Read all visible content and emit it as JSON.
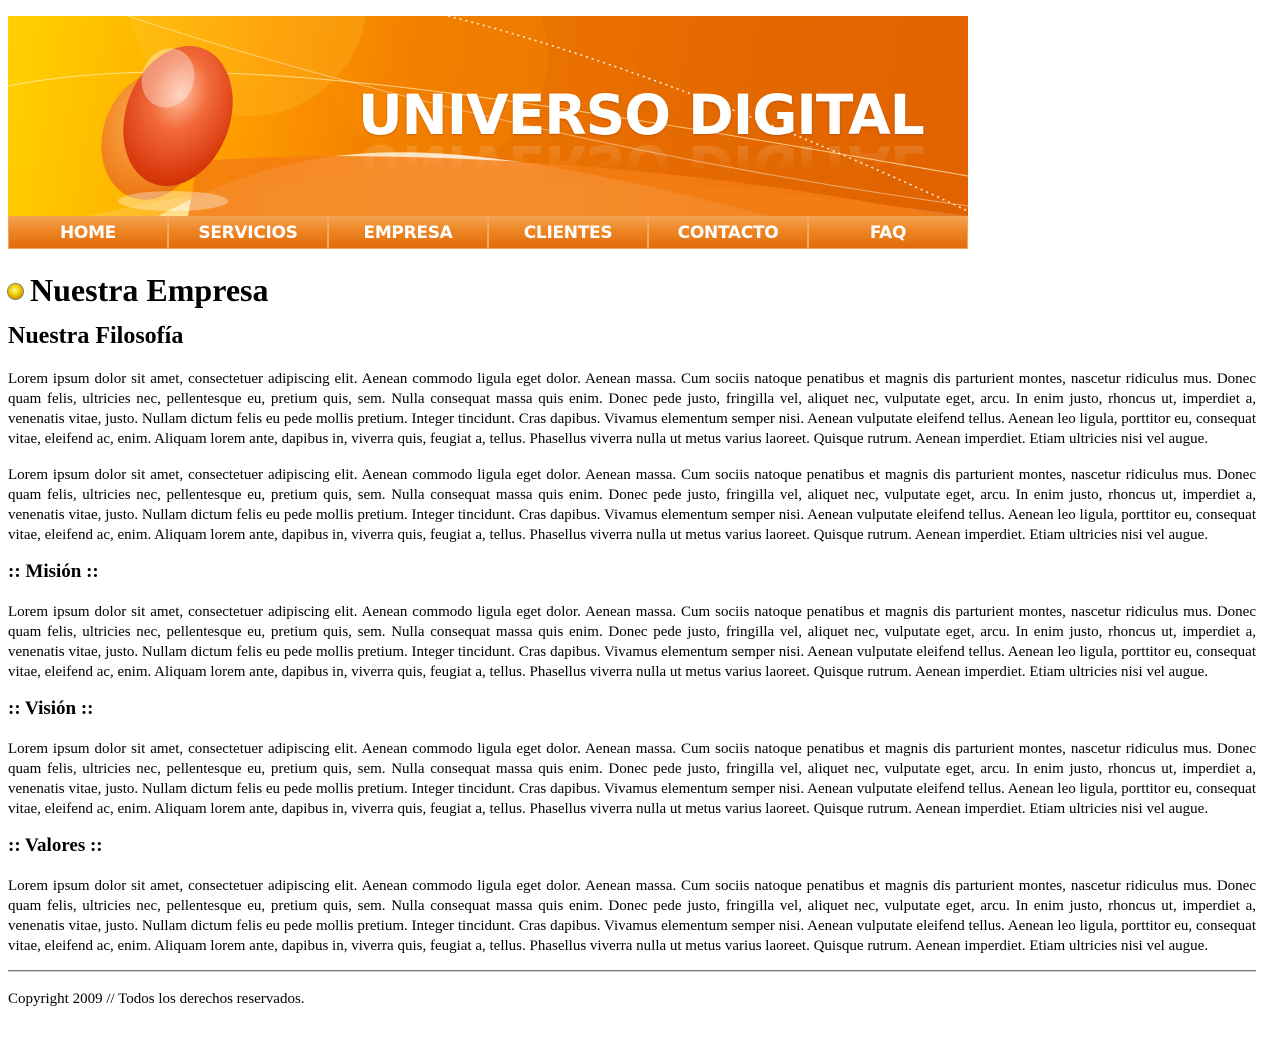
{
  "header": {
    "brand": "UNIVERSO DIGITAL",
    "colors": {
      "orange": "#e56a00",
      "yellow": "#ffd100",
      "nav": "#ee8524"
    }
  },
  "nav": {
    "items": [
      "HOME",
      "SERVICIOS",
      "EMPRESA",
      "CLIENTES",
      "CONTACTO",
      "FAQ"
    ]
  },
  "main": {
    "title": "Nuestra Empresa",
    "title_icon": "yellow-bullet-icon",
    "subtitle": "Nuestra Filosofía",
    "lorem": "Lorem ipsum dolor sit amet, consectetuer adipiscing elit. Aenean commodo ligula eget dolor. Aenean massa. Cum sociis natoque penatibus et magnis dis parturient montes, nascetur ridiculus mus. Donec quam felis, ultricies nec, pellentesque eu, pretium quis, sem. Nulla consequat massa quis enim. Donec pede justo, fringilla vel, aliquet nec, vulputate eget, arcu. In enim justo, rhoncus ut, imperdiet a, venenatis vitae, justo. Nullam dictum felis eu pede mollis pretium. Integer tincidunt. Cras dapibus. Vivamus elementum semper nisi. Aenean vulputate eleifend tellus. Aenean leo ligula, porttitor eu, consequat vitae, eleifend ac, enim. Aliquam lorem ante, dapibus in, viverra quis, feugiat a, tellus. Phasellus viverra nulla ut metus varius laoreet. Quisque rutrum. Aenean imperdiet. Etiam ultricies nisi vel augue.",
    "sections": {
      "mision": ":: Misión ::",
      "vision": ":: Visión ::",
      "valores": ":: Valores ::"
    }
  },
  "footer": {
    "text": "Copyright 2009 // Todos los derechos reservados."
  }
}
